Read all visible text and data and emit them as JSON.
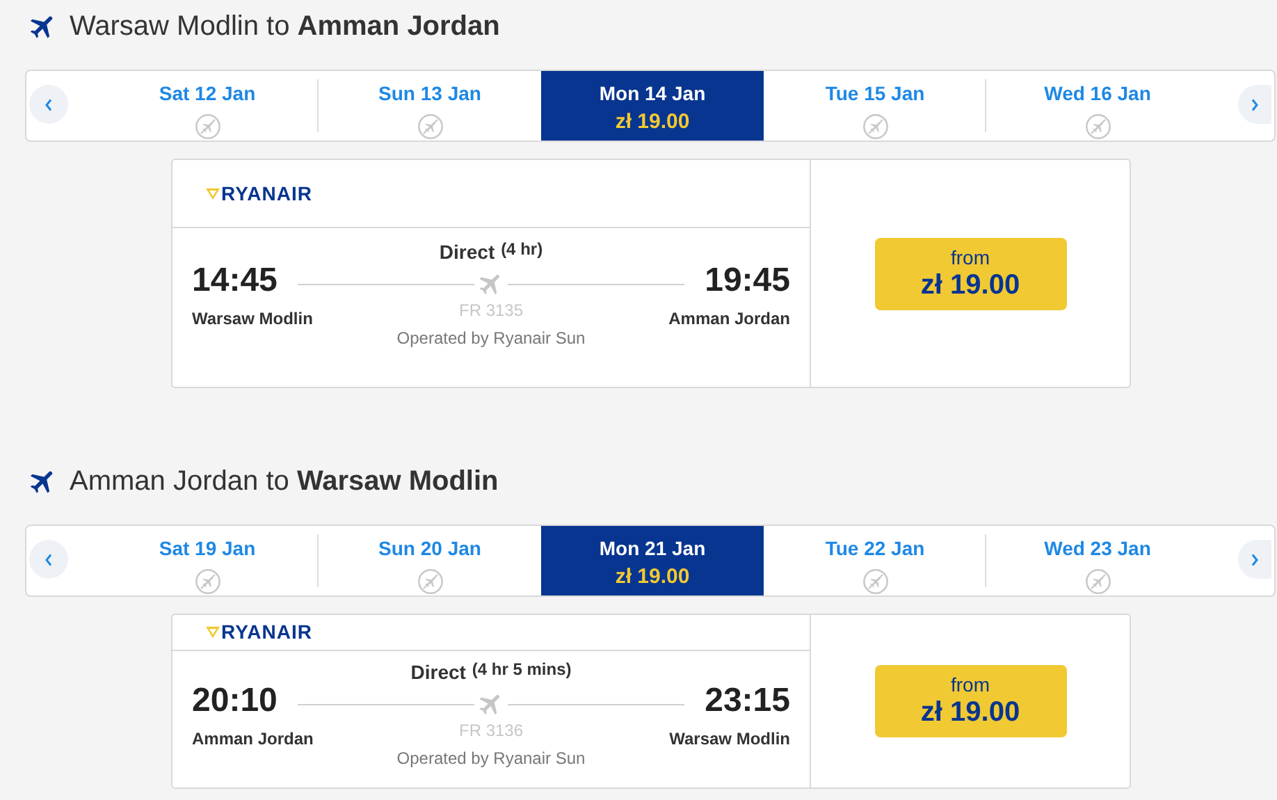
{
  "journeys": [
    {
      "origin": "Warsaw Modlin",
      "connector": "to",
      "destination": "Amman Jordan",
      "dates": [
        {
          "label": "Sat 12 Jan",
          "selected": false
        },
        {
          "label": "Sun 13 Jan",
          "selected": false
        },
        {
          "label": "Mon 14 Jan",
          "price": "zł 19.00",
          "selected": true
        },
        {
          "label": "Tue 15 Jan",
          "selected": false
        },
        {
          "label": "Wed 16 Jan",
          "selected": false
        }
      ],
      "flight": {
        "airline": "RYANAIR",
        "type": "Direct",
        "duration": "(4 hr)",
        "depart_time": "14:45",
        "depart_city": "Warsaw Modlin",
        "arrive_time": "19:45",
        "arrive_city": "Amman Jordan",
        "number": "FR 3135",
        "operator": "Operated by Ryanair Sun",
        "price_label": "from",
        "price": "zł 19.00"
      }
    },
    {
      "origin": "Amman Jordan",
      "connector": "to",
      "destination": "Warsaw Modlin",
      "dates": [
        {
          "label": "Sat 19 Jan",
          "selected": false
        },
        {
          "label": "Sun 20 Jan",
          "selected": false
        },
        {
          "label": "Mon 21 Jan",
          "price": "zł 19.00",
          "selected": true
        },
        {
          "label": "Tue 22 Jan",
          "selected": false
        },
        {
          "label": "Wed 23 Jan",
          "selected": false
        }
      ],
      "flight": {
        "airline": "RYANAIR",
        "type": "Direct",
        "duration": "(4 hr 5 mins)",
        "depart_time": "20:10",
        "depart_city": "Amman Jordan",
        "arrive_time": "23:15",
        "arrive_city": "Warsaw Modlin",
        "number": "FR 3136",
        "operator": "Operated by Ryanair Sun",
        "price_label": "from",
        "price": "zł 19.00"
      }
    }
  ]
}
